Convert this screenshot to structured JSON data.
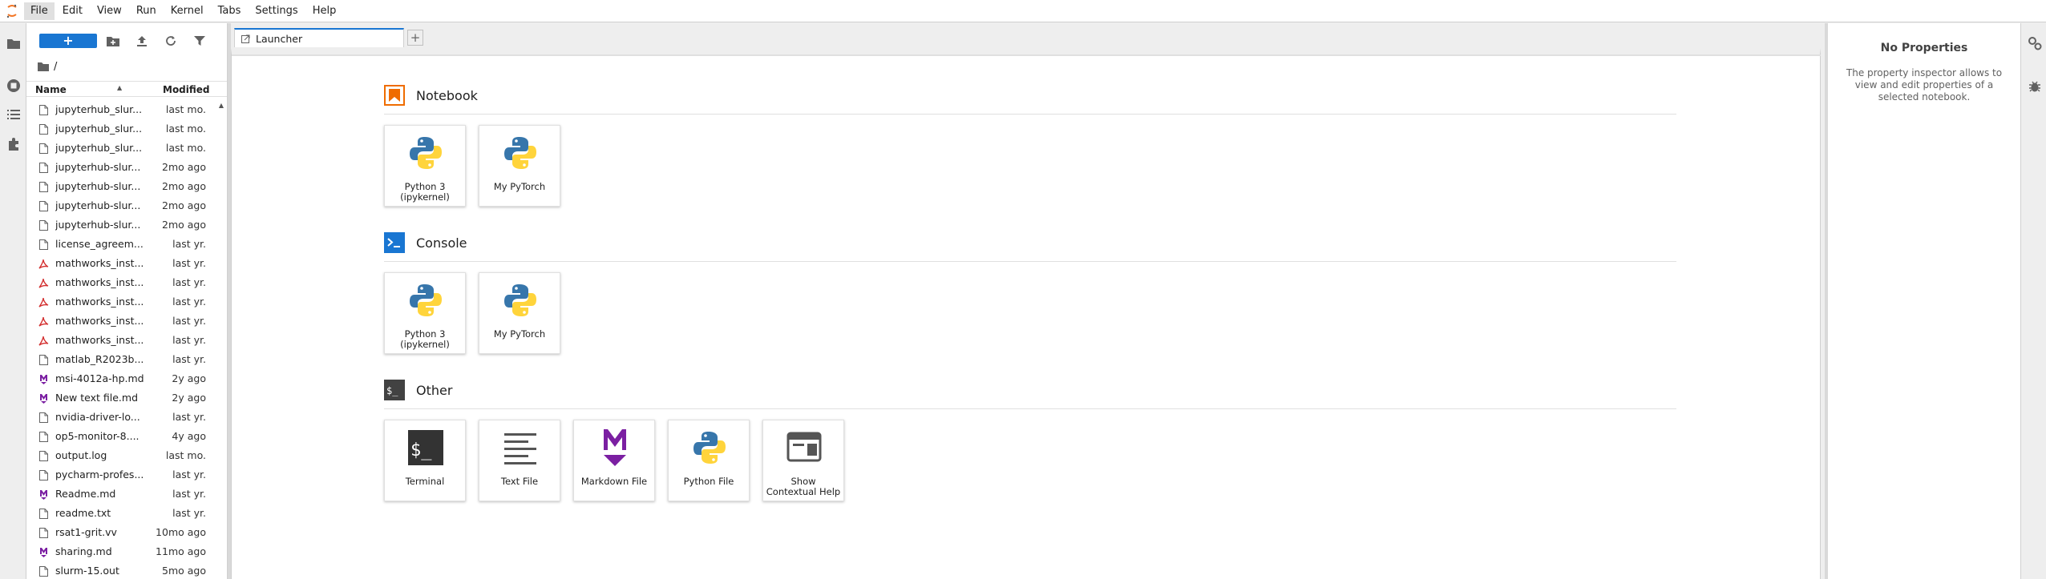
{
  "menubar": {
    "items": [
      "File",
      "Edit",
      "View",
      "Run",
      "Kernel",
      "Tabs",
      "Settings",
      "Help"
    ]
  },
  "filebrowser": {
    "new_label": "+",
    "path": "/",
    "columns": {
      "name": "Name",
      "modified": "Modified"
    },
    "files": [
      {
        "name": "jupyterhub_slur...",
        "modified": "last mo.",
        "icon": "file-icon"
      },
      {
        "name": "jupyterhub_slur...",
        "modified": "last mo.",
        "icon": "file-icon"
      },
      {
        "name": "jupyterhub_slur...",
        "modified": "last mo.",
        "icon": "file-icon"
      },
      {
        "name": "jupyterhub-slur...",
        "modified": "2mo ago",
        "icon": "file-icon"
      },
      {
        "name": "jupyterhub-slur...",
        "modified": "2mo ago",
        "icon": "file-icon"
      },
      {
        "name": "jupyterhub-slur...",
        "modified": "2mo ago",
        "icon": "file-icon"
      },
      {
        "name": "jupyterhub-slur...",
        "modified": "2mo ago",
        "icon": "file-icon"
      },
      {
        "name": "license_agreem...",
        "modified": "last yr.",
        "icon": "file-icon"
      },
      {
        "name": "mathworks_inst...",
        "modified": "last yr.",
        "icon": "pdf-icon"
      },
      {
        "name": "mathworks_inst...",
        "modified": "last yr.",
        "icon": "pdf-icon"
      },
      {
        "name": "mathworks_inst...",
        "modified": "last yr.",
        "icon": "pdf-icon"
      },
      {
        "name": "mathworks_inst...",
        "modified": "last yr.",
        "icon": "pdf-icon"
      },
      {
        "name": "mathworks_inst...",
        "modified": "last yr.",
        "icon": "pdf-icon"
      },
      {
        "name": "matlab_R2023b...",
        "modified": "last yr.",
        "icon": "file-icon"
      },
      {
        "name": "msi-4012a-hp.md",
        "modified": "2y ago",
        "icon": "markdown-icon"
      },
      {
        "name": "New text file.md",
        "modified": "2y ago",
        "icon": "markdown-icon"
      },
      {
        "name": "nvidia-driver-lo...",
        "modified": "last yr.",
        "icon": "file-icon"
      },
      {
        "name": "op5-monitor-8....",
        "modified": "4y ago",
        "icon": "file-icon"
      },
      {
        "name": "output.log",
        "modified": "last mo.",
        "icon": "file-icon"
      },
      {
        "name": "pycharm-profes...",
        "modified": "last yr.",
        "icon": "file-icon"
      },
      {
        "name": "Readme.md",
        "modified": "last yr.",
        "icon": "markdown-icon"
      },
      {
        "name": "readme.txt",
        "modified": "last yr.",
        "icon": "file-icon"
      },
      {
        "name": "rsat1-grit.vv",
        "modified": "10mo ago",
        "icon": "file-icon"
      },
      {
        "name": "sharing.md",
        "modified": "11mo ago",
        "icon": "markdown-icon"
      },
      {
        "name": "slurm-15.out",
        "modified": "5mo ago",
        "icon": "file-icon"
      }
    ]
  },
  "tabs": {
    "active_label": "Launcher",
    "add_label": "+"
  },
  "launcher": {
    "sections": [
      {
        "title": "Notebook",
        "icon": "notebook-icon",
        "cards": [
          {
            "label": "Python 3 (ipykernel)",
            "icon": "python-icon"
          },
          {
            "label": "My PyTorch",
            "icon": "python-icon"
          }
        ]
      },
      {
        "title": "Console",
        "icon": "console-icon",
        "cards": [
          {
            "label": "Python 3 (ipykernel)",
            "icon": "python-icon"
          },
          {
            "label": "My PyTorch",
            "icon": "python-icon"
          }
        ]
      },
      {
        "title": "Other",
        "icon": "other-icon",
        "cards": [
          {
            "label": "Terminal",
            "icon": "terminal-icon"
          },
          {
            "label": "Text File",
            "icon": "text-file-icon"
          },
          {
            "label": "Markdown File",
            "icon": "markdown-icon"
          },
          {
            "label": "Python File",
            "icon": "python-icon"
          },
          {
            "label": "Show Contextual Help",
            "icon": "contextual-help-icon"
          }
        ]
      }
    ]
  },
  "properties": {
    "title": "No Properties",
    "text": "The property inspector allows to view and edit properties of a selected notebook."
  },
  "colors": {
    "accent": "#1976d2",
    "notebook": "#ef6c00",
    "markdown": "#7b1fa2",
    "pdf": "#d32f2f"
  }
}
